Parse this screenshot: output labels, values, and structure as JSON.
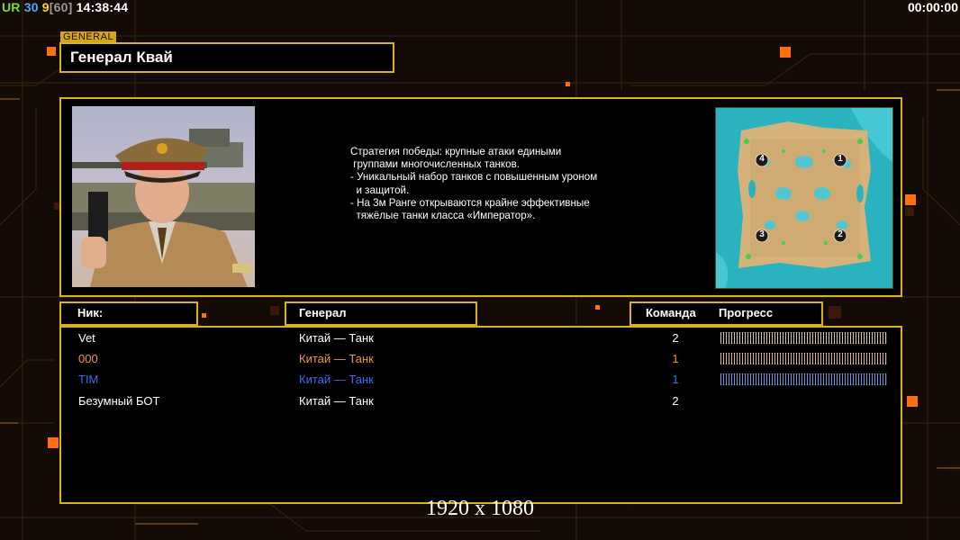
{
  "hud": {
    "ur": "UR",
    "v30": "30",
    "v9": "9",
    "v60": "[60]",
    "clock": "14:38:44",
    "timer": "00:00:00"
  },
  "general": {
    "tag": "GENERAL",
    "name": "Генерал Квай"
  },
  "strategy_lines": [
    "Стратегия победы: крупные атаки едиными",
    " группами многочисленных танков.",
    "",
    "- Уникальный набор танков с повышенным уроном",
    "  и защитой.",
    "",
    "- На 3м Ранге открываются крайне эффективные",
    "  тяжёлые танки класса «Император»."
  ],
  "map": {
    "spawns": [
      "1",
      "2",
      "3",
      "4"
    ]
  },
  "columns": {
    "nick": "Ник:",
    "general": "Генерал",
    "team": "Команда",
    "progress": "Прогресс"
  },
  "players": [
    {
      "nick": "Vet",
      "general": "Китай — Танк",
      "team": "2",
      "color": "#ffffff",
      "bar": "#d8c9a0",
      "progress": 1.0
    },
    {
      "nick": "000",
      "general": "Китай — Танк",
      "team": "1",
      "color": "#f0982a",
      "bar": "#d8b87a",
      "progress": 1.0
    },
    {
      "nick": "TIM",
      "general": "Китай — Танк",
      "team": "1",
      "color": "#3a6ef0",
      "bar": "#6f8fe6",
      "progress": 1.0
    },
    {
      "nick": "Безумный БОТ",
      "general": "Китай — Танк",
      "team": "2",
      "color": "#ffffff",
      "bar": "",
      "progress": 0
    }
  ],
  "resolution": "1920 x 1080",
  "colors": {
    "accent": "#d9b21c",
    "background": "#140b06",
    "glow_orange": "#ff7a12"
  }
}
